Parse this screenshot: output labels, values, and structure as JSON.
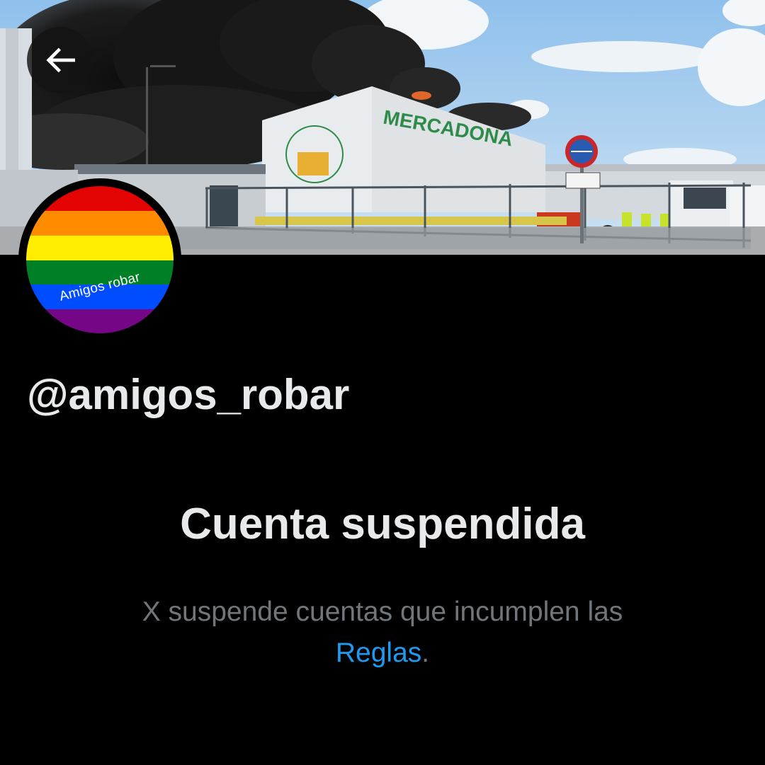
{
  "banner": {
    "building_sign": "MERCADONA"
  },
  "navigation": {
    "back_icon": "arrow-left-icon"
  },
  "avatar": {
    "text": "Amigos robar",
    "stripe_colors": [
      "#e40303",
      "#ff8c00",
      "#ffed00",
      "#008026",
      "#004dff",
      "#750787"
    ]
  },
  "profile": {
    "handle": "@amigos_robar"
  },
  "suspension": {
    "title": "Cuenta suspendida",
    "description": "X suspende cuentas que incumplen las",
    "rules_link": "Reglas",
    "period": "."
  },
  "colors": {
    "background": "#000000",
    "primary_text": "#e7e9ea",
    "secondary_text": "#71767b",
    "link": "#1d9bf0"
  }
}
